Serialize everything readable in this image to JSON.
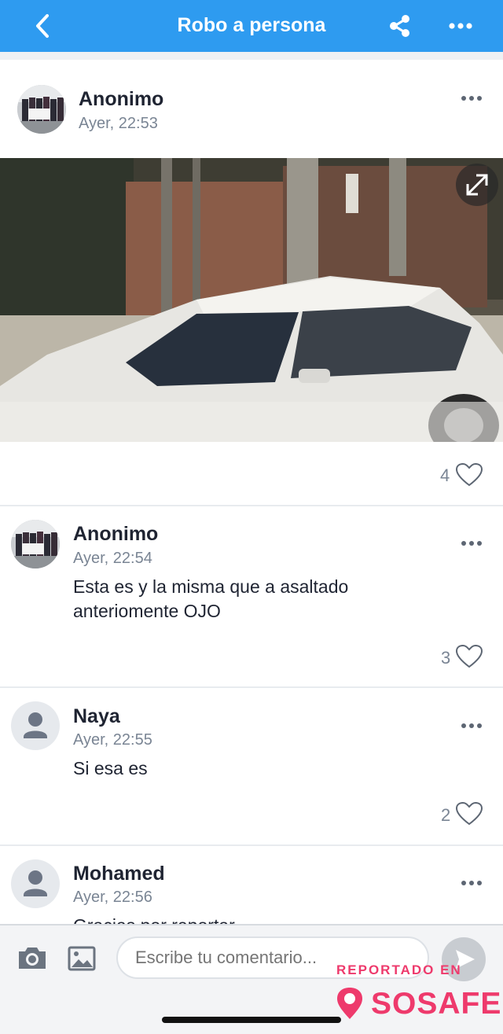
{
  "header": {
    "title": "Robo a persona",
    "back_icon": "chevron-left-icon",
    "share_icon": "share-icon",
    "more_icon": "more-horizontal-icon",
    "background": "#2e9bf0"
  },
  "post": {
    "author": "Anonimo",
    "time": "Ayer, 22:53",
    "likes": "4",
    "image_desc_icon": "expand-icon"
  },
  "comments": [
    {
      "author": "Anonimo",
      "time": "Ayer, 22:54",
      "text_line1": "Esta es y la misma que  a asaltado",
      "text_line2": "anteriomente OJO",
      "likes": "3",
      "avatar": "photo"
    },
    {
      "author": "Naya",
      "time": "Ayer, 22:55",
      "text_line1": "Si esa es",
      "likes": "2",
      "avatar": "generic-user"
    },
    {
      "author": "Mohamed",
      "time": "Ayer, 22:56",
      "text_line1": "Gracias por reportar",
      "avatar": "generic-user"
    }
  ],
  "composer": {
    "placeholder": "Escribe tu comentario...",
    "camera_icon": "camera-icon",
    "gallery_icon": "image-icon",
    "send_icon": "send-icon"
  },
  "watermark": {
    "top": "REPORTADO EN",
    "brand": "SOSAFE",
    "color": "#ee3a6c"
  }
}
